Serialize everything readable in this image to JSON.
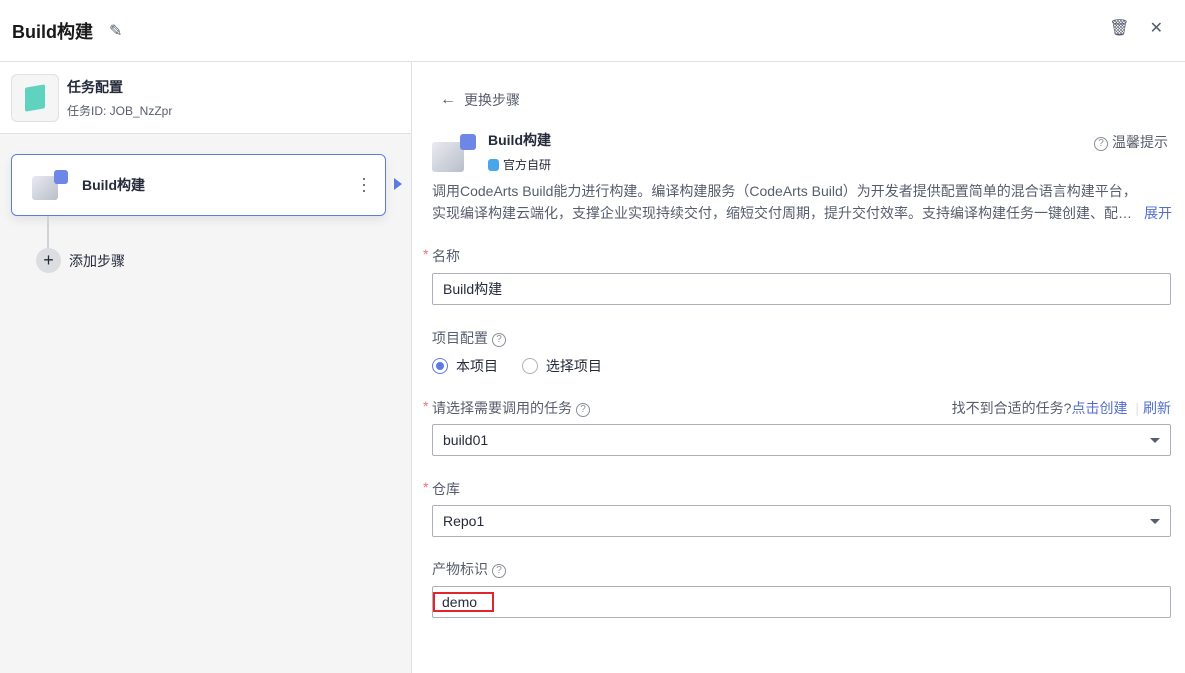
{
  "header": {
    "title": "Build构建"
  },
  "left": {
    "job_title": "任务配置",
    "job_id": "任务ID: JOB_NzZpr",
    "step_label": "Build构建",
    "add_step": "添加步骤"
  },
  "right": {
    "back_label": "更换步骤",
    "plugin_name": "Build构建",
    "plugin_badge": "官方自研",
    "tip_label": "温馨提示",
    "desc_line1": "调用CodeArts Build能力进行构建。编译构建服务（CodeArts Build）为开发者提供配置简单的混合语言构建平台，",
    "desc_line2": "实现编译构建云端化，支撑企业实现持续交付，缩短交付周期，提升交付效率。支持编译构建任务一键创建、配…",
    "expand": "展开",
    "name_label": "名称",
    "name_value": "Build构建",
    "project_label": "项目配置",
    "radio_current": "本项目",
    "radio_select": "选择项目",
    "task_label": "请选择需要调用的任务",
    "task_hint": "找不到合适的任务?",
    "task_create": "点击创建",
    "task_refresh": "刷新",
    "task_value": "build01",
    "repo_label": "仓库",
    "repo_value": "Repo1",
    "artifact_label": "产物标识",
    "artifact_value": "demo"
  }
}
